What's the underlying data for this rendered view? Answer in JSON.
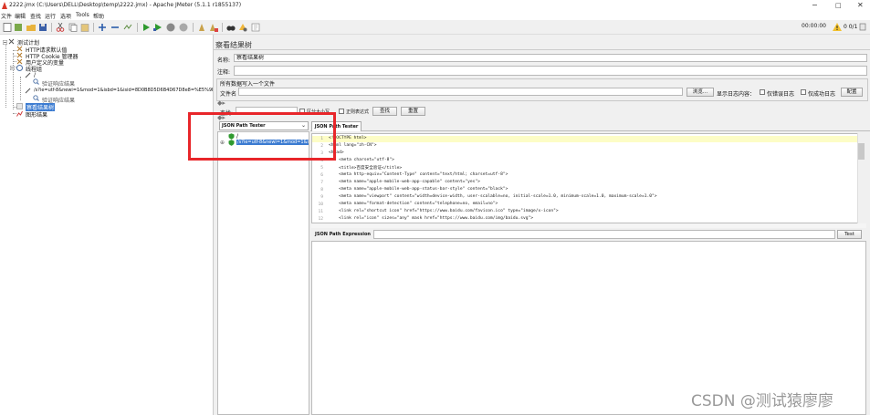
{
  "window": {
    "title": "2222.jmx (C:\\Users\\DELL\\Desktop\\temp\\2222.jmx) - Apache JMeter (5.1.1 r1855137)"
  },
  "menu": [
    "文件",
    "编辑",
    "查找",
    "运行",
    "选项",
    "Tools",
    "帮助"
  ],
  "toolbar": {
    "timer": "00:00:00",
    "error_count": "0  0/1"
  },
  "tree": {
    "items": [
      {
        "label": "测试计划"
      },
      {
        "label": "HTTP请求默认值"
      },
      {
        "label": "HTTP Cookie 管理器"
      },
      {
        "label": "用户定义的变量"
      },
      {
        "label": "线程组"
      },
      {
        "label": "/"
      },
      {
        "label": "验证响应结果"
      },
      {
        "label": "/s?ie=utf-8&newi=1&mod=1&isbd=1&isid=8D0B8D5D6B4D67D8e8=%E5%9B%BE..."
      },
      {
        "label": "验证响应结果"
      },
      {
        "label": "察看结果树",
        "selected": true
      },
      {
        "label": "图形结果"
      }
    ]
  },
  "panel": {
    "title": "察看结果树",
    "name_label": "名称:",
    "name_value": "察看结果树",
    "comment_label": "注释:",
    "file_section": "所有数据写入一个文件",
    "file_label": "文件名",
    "browse": "浏览...",
    "log_label": "显示日志内容：",
    "only_errors": "仅错误日志",
    "only_success": "仅成功日志",
    "configure": "配置",
    "search_label": "查找:",
    "case_label": "区分大小写",
    "regex_label": "正则表达式",
    "find_btn": "查找",
    "reset_btn": "重置"
  },
  "result": {
    "combo": "JSON Path Tester",
    "tree_root": "/",
    "tree_child": "/s?ie=utf-8&newi=1&mod=1&i",
    "tab": "JSON Path Tester",
    "code_lines": [
      "<!DOCTYPE html>",
      "<html lang=\"zh-CN\">",
      "<head>",
      "    <meta charset=\"utf-8\">",
      "    <title>百度安全验证</title>",
      "    <meta http-equiv=\"Content-Type\" content=\"text/html; charset=utf-8\">",
      "    <meta name=\"apple-mobile-web-app-capable\" content=\"yes\">",
      "    <meta name=\"apple-mobile-web-app-status-bar-style\" content=\"black\">",
      "    <meta name=\"viewport\" content=\"width=device-width, user-scalable=no, initial-scale=1.0, minimum-scale=1.0, maximum-scale=1.0\">",
      "    <meta name=\"format-detection\" content=\"telephone=no, email=no\">",
      "    <link rel=\"shortcut icon\" href=\"https://www.baidu.com/favicon.ico\" type=\"image/x-icon\">",
      "    <link rel=\"icon\" sizes=\"any\" mask href=\"https://www.baidu.com/img/baidu.svg\">"
    ],
    "expression_label": "JSON Path Expression",
    "test_btn": "Test"
  },
  "watermark": "CSDN @测试猿廖廖",
  "colors": {
    "selection": "#3b7bd1",
    "annotation": "#e8262a",
    "highlight_line": "#fdfdc6"
  }
}
